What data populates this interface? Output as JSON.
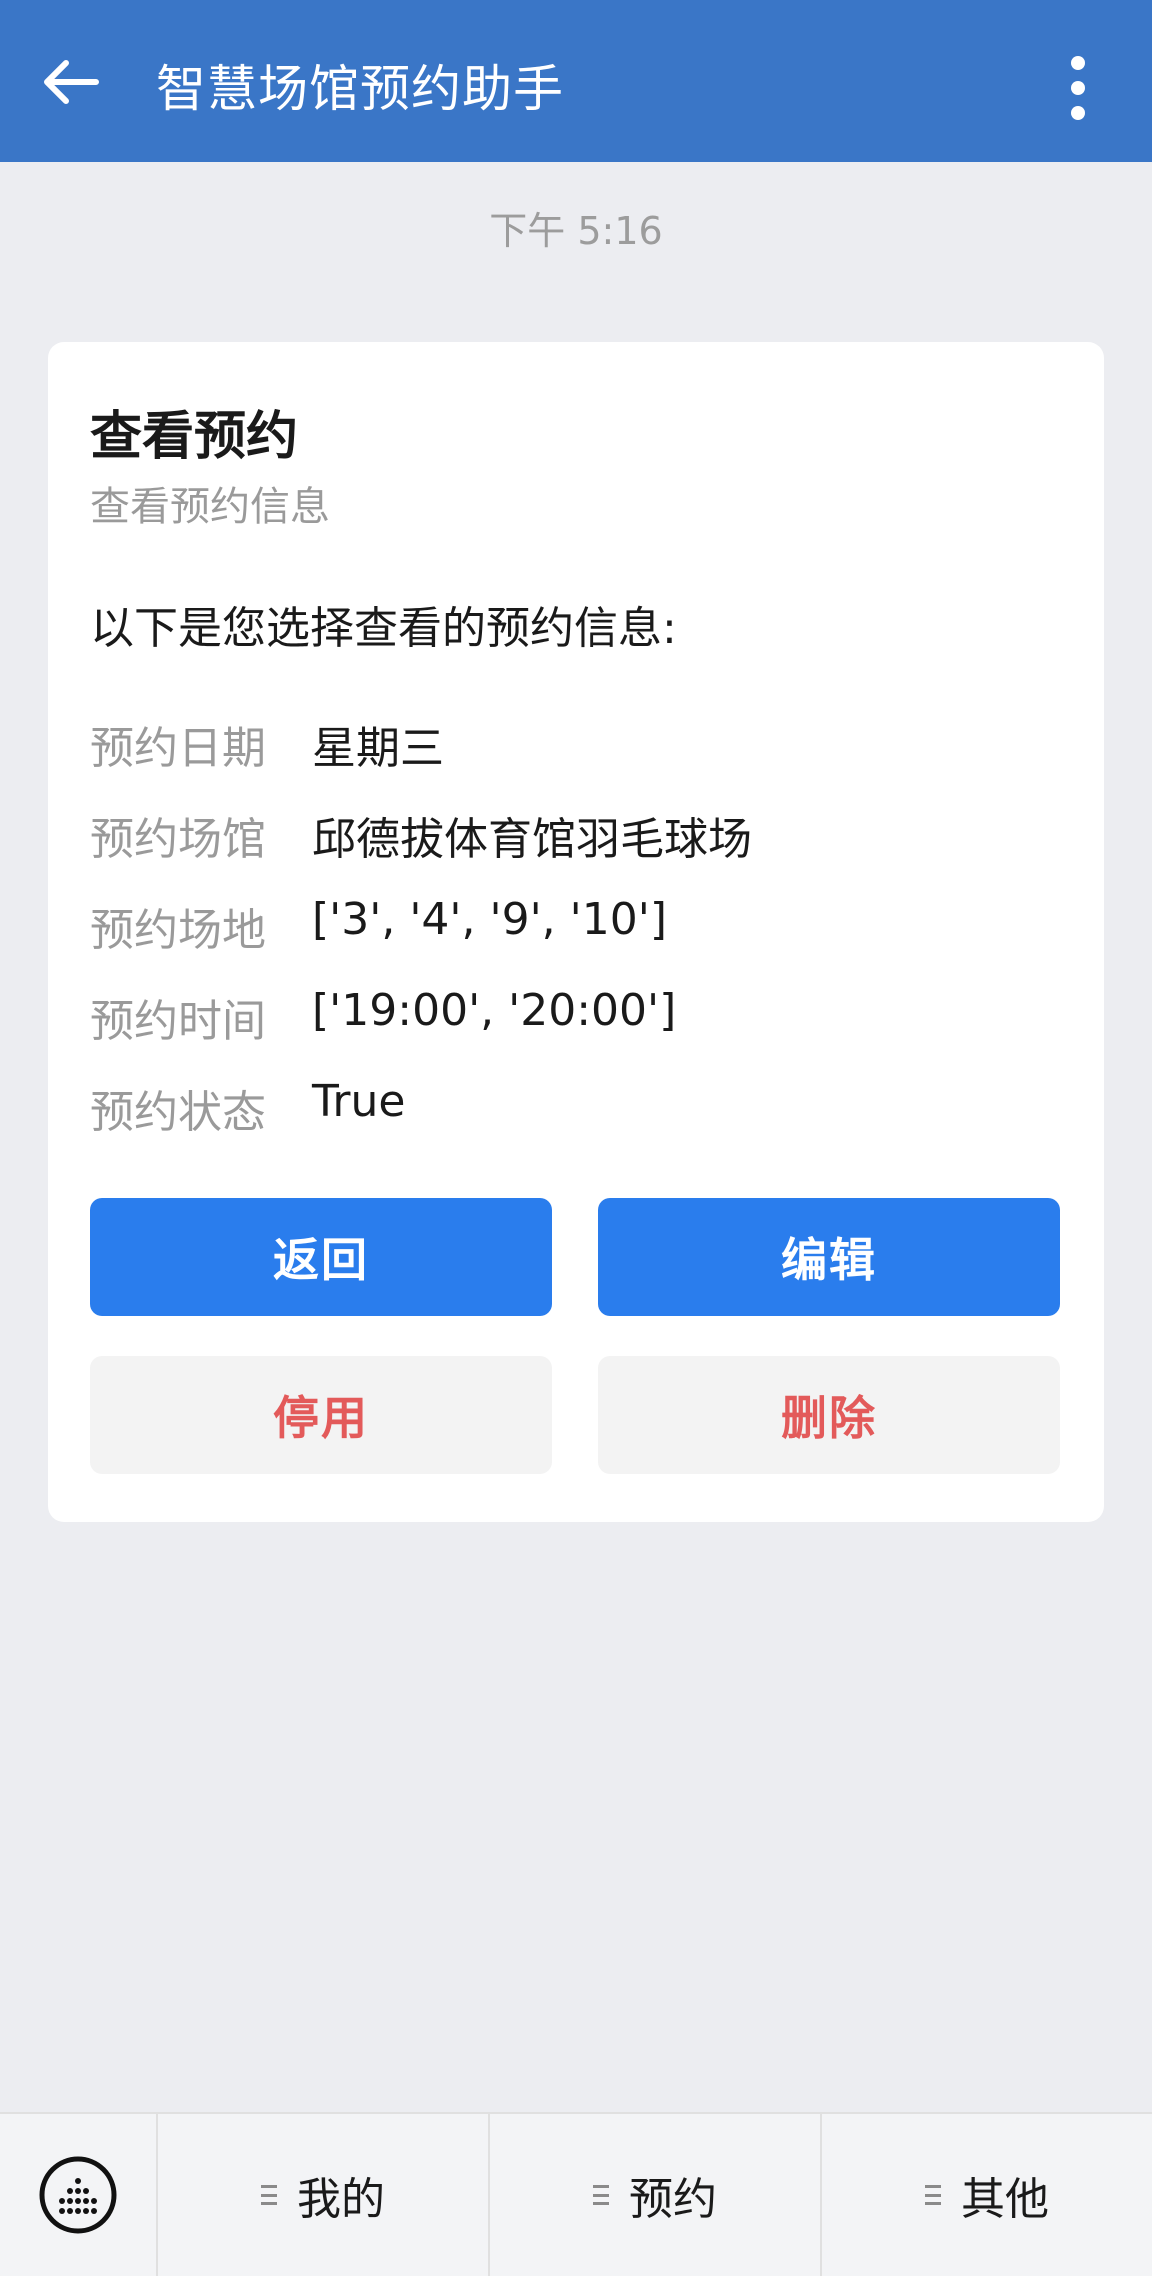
{
  "header": {
    "title": "智慧场馆预约助手"
  },
  "timestamp": "下午 5:16",
  "card": {
    "title": "查看预约",
    "subtitle": "查看预约信息",
    "intro": "以下是您选择查看的预约信息:",
    "rows": [
      {
        "label": "预约日期",
        "value": "星期三"
      },
      {
        "label": "预约场馆",
        "value": "邱德拔体育馆羽毛球场"
      },
      {
        "label": "预约场地",
        "value": "['3', '4', '9', '10']"
      },
      {
        "label": "预约时间",
        "value": "['19:00', '20:00']"
      },
      {
        "label": "预约状态",
        "value": "True"
      }
    ],
    "buttons": {
      "back": "返回",
      "edit": "编辑",
      "disable": "停用",
      "delete": "删除"
    }
  },
  "bottom_nav": {
    "items": [
      {
        "label": "我的"
      },
      {
        "label": "预约"
      },
      {
        "label": "其他"
      }
    ]
  },
  "colors": {
    "header_bg": "#3a76c7",
    "primary_button": "#2a7ded",
    "danger_text": "#e35a5a"
  }
}
